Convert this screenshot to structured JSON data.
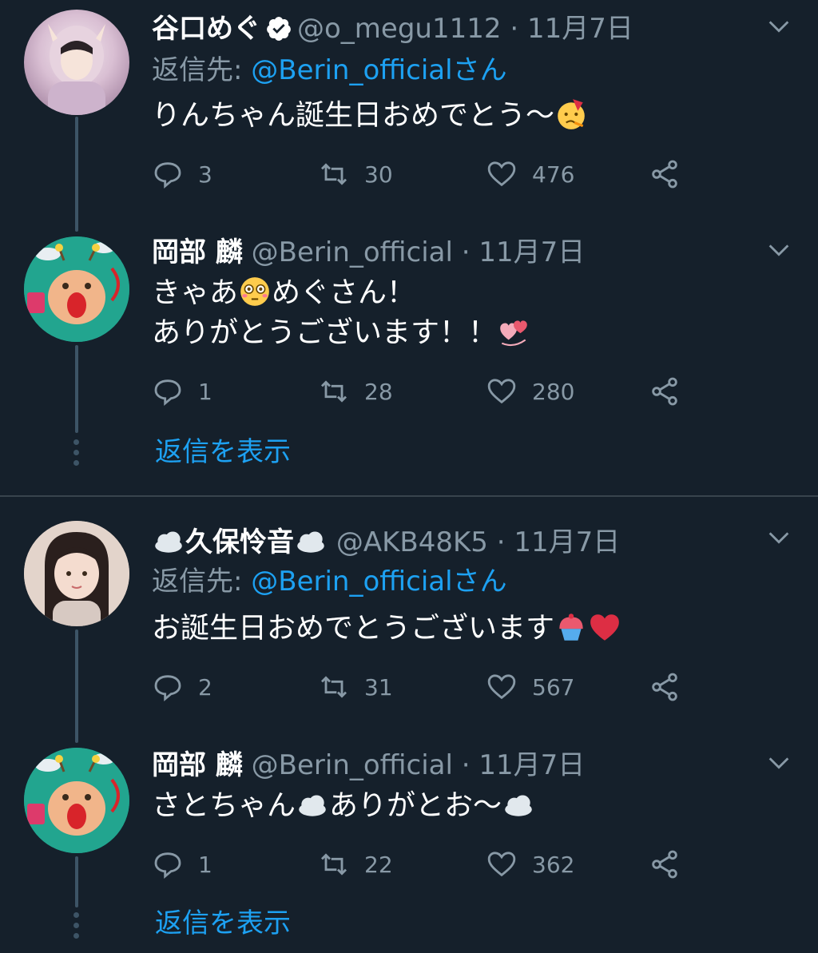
{
  "tweets": [
    {
      "name": "谷口めぐ",
      "verified": true,
      "handle": "@o_megu1112",
      "sep": "·",
      "date": "11月7日",
      "replying_label": "返信先: ",
      "replying_link": "@Berin_officialさん",
      "text_lines": [
        "りんちゃん誕生日おめでとう〜"
      ],
      "reply_count": "3",
      "retweet_count": "30",
      "like_count": "476"
    },
    {
      "name": "岡部 麟",
      "handle": "@Berin_official",
      "sep": "·",
      "date": "11月7日",
      "text_lines": [
        "きゃあ",
        "めぐさん！",
        "ありがとうございます！！"
      ],
      "reply_count": "1",
      "retweet_count": "28",
      "like_count": "280"
    },
    {
      "name": "久保怜音",
      "handle": "@AKB48K5",
      "sep": "·",
      "date": "11月7日",
      "replying_label": "返信先: ",
      "replying_link": "@Berin_officialさん",
      "text_lines": [
        "お誕生日おめでとうございます"
      ],
      "reply_count": "2",
      "retweet_count": "31",
      "like_count": "567"
    },
    {
      "name": "岡部 麟",
      "handle": "@Berin_official",
      "sep": "·",
      "date": "11月7日",
      "text_lines": [
        "さとちゃん",
        "ありがとお〜"
      ],
      "reply_count": "1",
      "retweet_count": "22",
      "like_count": "362"
    }
  ],
  "show_replies_label": "返信を表示",
  "colors": {
    "background": "#15202b",
    "text": "#ffffff",
    "muted": "#8899a6",
    "link": "#1da1f2",
    "thread": "#3d5466"
  },
  "icons": [
    "verified-badge-icon",
    "chevron-down-icon",
    "reply-icon",
    "retweet-icon",
    "like-icon",
    "share-icon"
  ]
}
